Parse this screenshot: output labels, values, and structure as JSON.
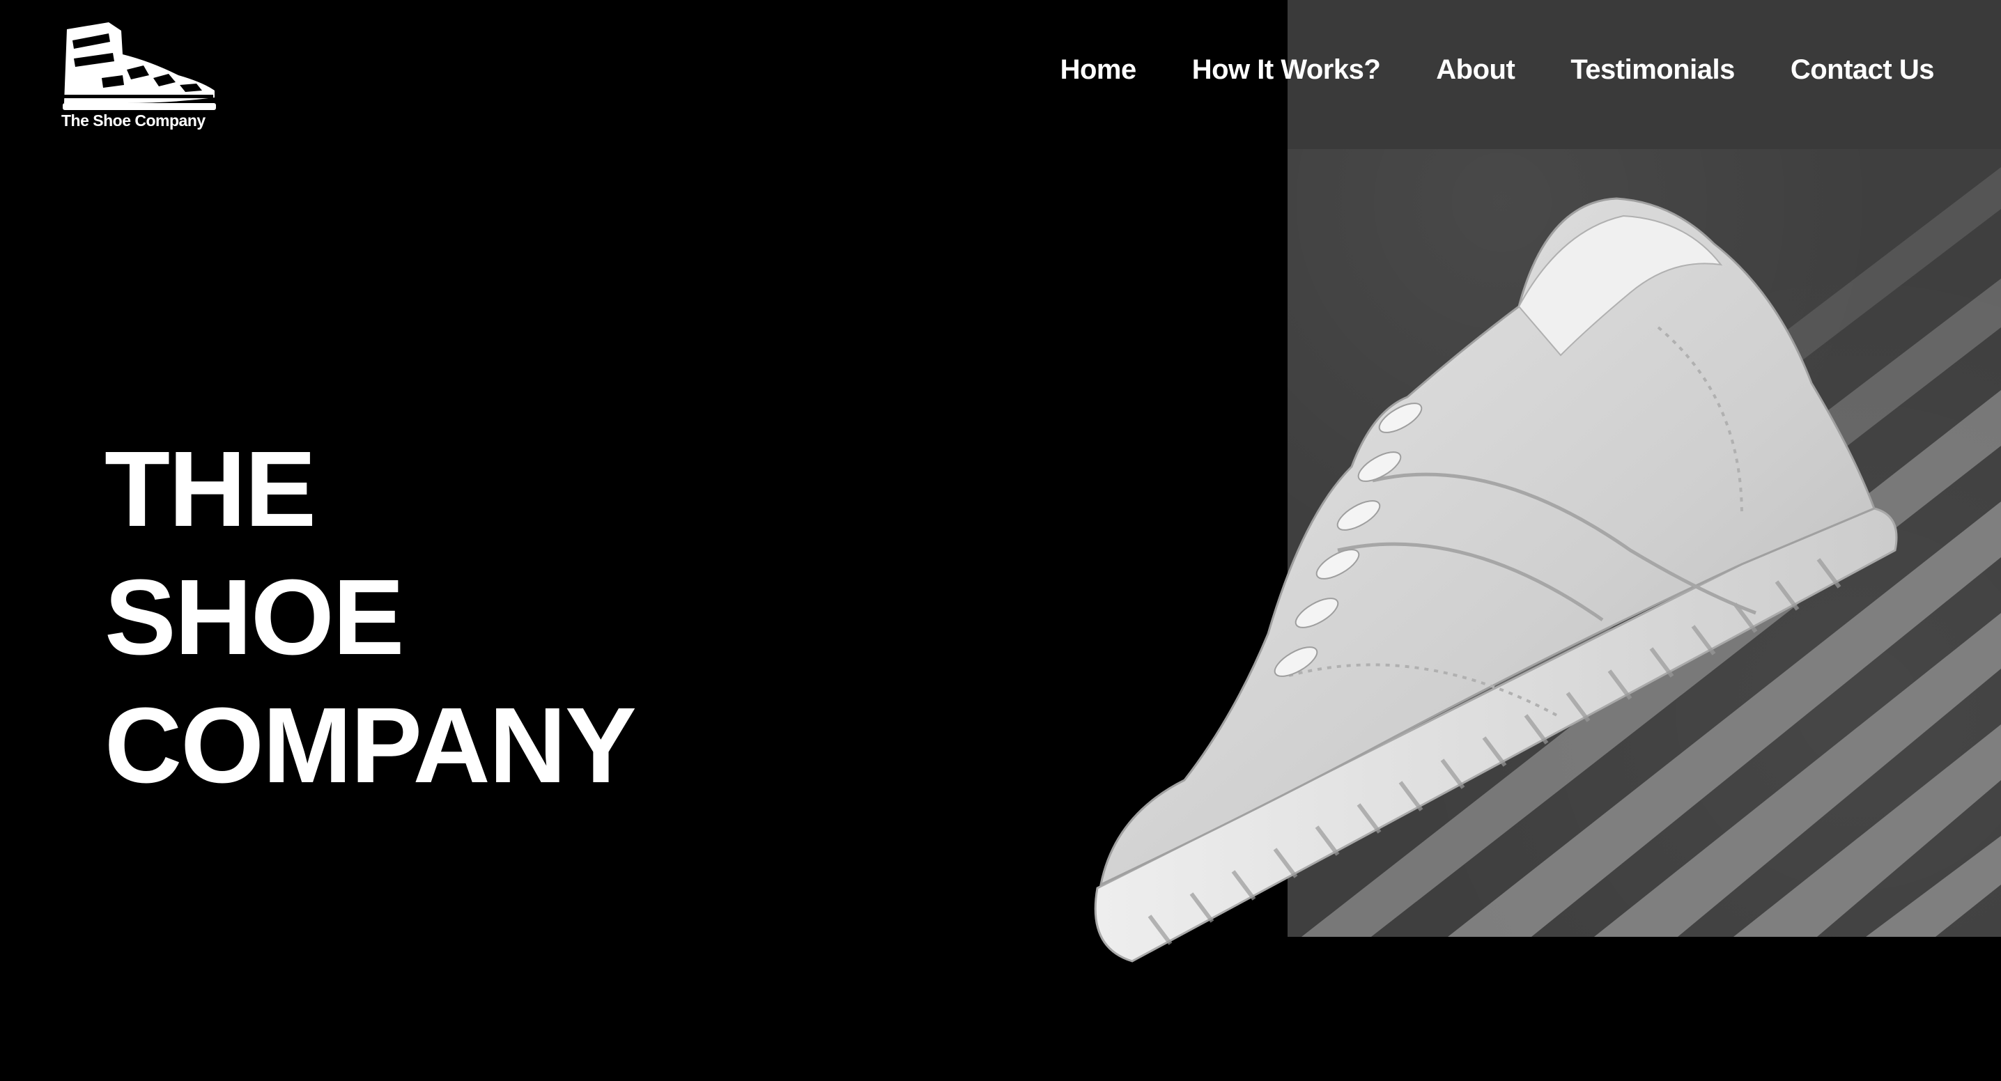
{
  "brand": {
    "name": "The Shoe Company",
    "logo_icon": "sneaker-icon"
  },
  "nav": {
    "items": [
      {
        "label": "Home"
      },
      {
        "label": "How It Works?"
      },
      {
        "label": "About"
      },
      {
        "label": "Testimonials"
      },
      {
        "label": "Contact Us"
      }
    ]
  },
  "hero": {
    "title_lines": [
      "THE",
      "SHOE",
      "COMPANY"
    ],
    "image": "white-sneaker-on-crosswalk"
  },
  "colors": {
    "background": "#000000",
    "text": "#ffffff",
    "nav_overlay": "#3a3a3a",
    "asphalt": "#3f3f3f",
    "crosswalk": "#8a8a8a",
    "shoe": "#d6d6d6"
  }
}
